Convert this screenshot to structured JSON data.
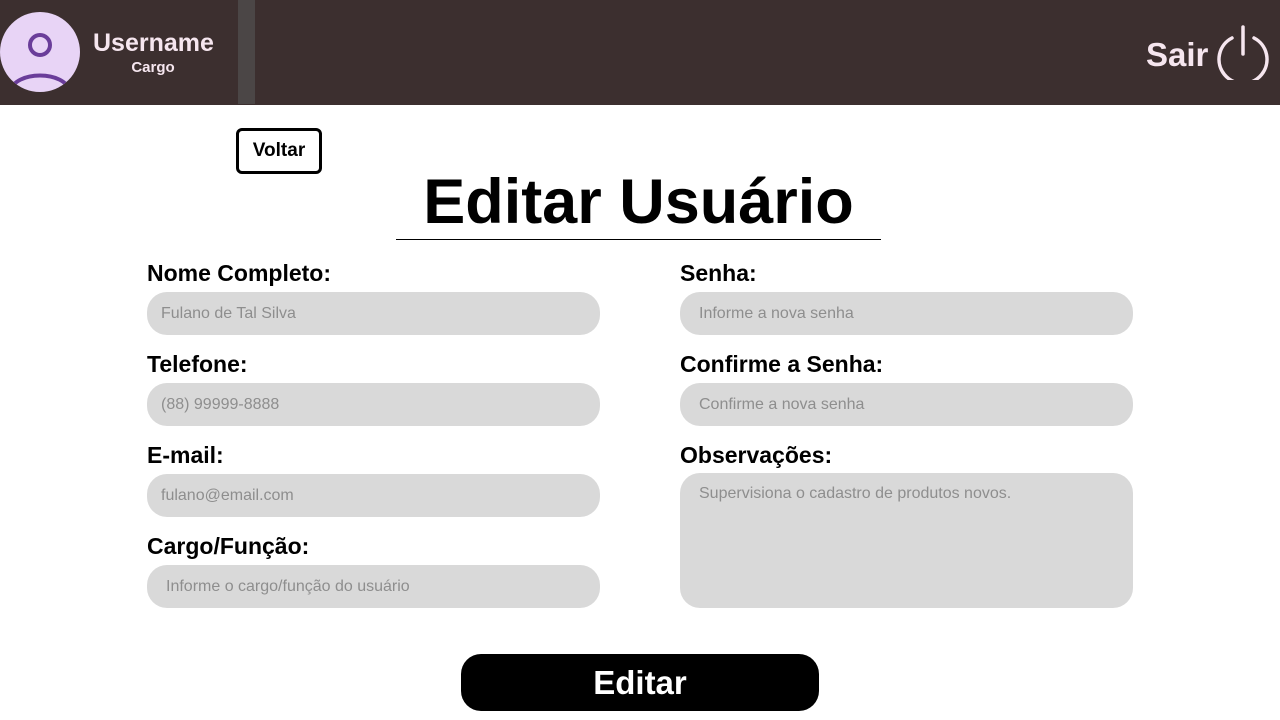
{
  "header": {
    "user_name": "Username",
    "user_role": "Cargo",
    "logout_label": "Sair",
    "icons": {
      "avatar": "user-icon",
      "logout": "power-icon"
    },
    "colors": {
      "background": "#3c2f2f",
      "text": "#f6e6ef",
      "avatar_bg": "#e8d4f6",
      "avatar_fg": "#6a3d9a"
    }
  },
  "back_button": {
    "label": "Voltar"
  },
  "page_title": "Editar Usuário",
  "form": {
    "left": [
      {
        "label": "Nome Completo:",
        "placeholder": "Fulano de Tal Silva"
      },
      {
        "label": "Telefone:",
        "placeholder": "(88) 99999-8888"
      },
      {
        "label": "E-mail:",
        "placeholder": "fulano@email.com"
      },
      {
        "label": "Cargo/Função:",
        "placeholder": "Informe o cargo/função do usuário"
      }
    ],
    "right": [
      {
        "label": "Senha:",
        "placeholder": "Informe a nova senha"
      },
      {
        "label": "Confirme a Senha:",
        "placeholder": "Confirme a nova senha"
      },
      {
        "label": "Observações:",
        "placeholder": "Supervisiona o cadastro de produtos novos."
      }
    ]
  },
  "submit_button": {
    "label": "Editar"
  }
}
